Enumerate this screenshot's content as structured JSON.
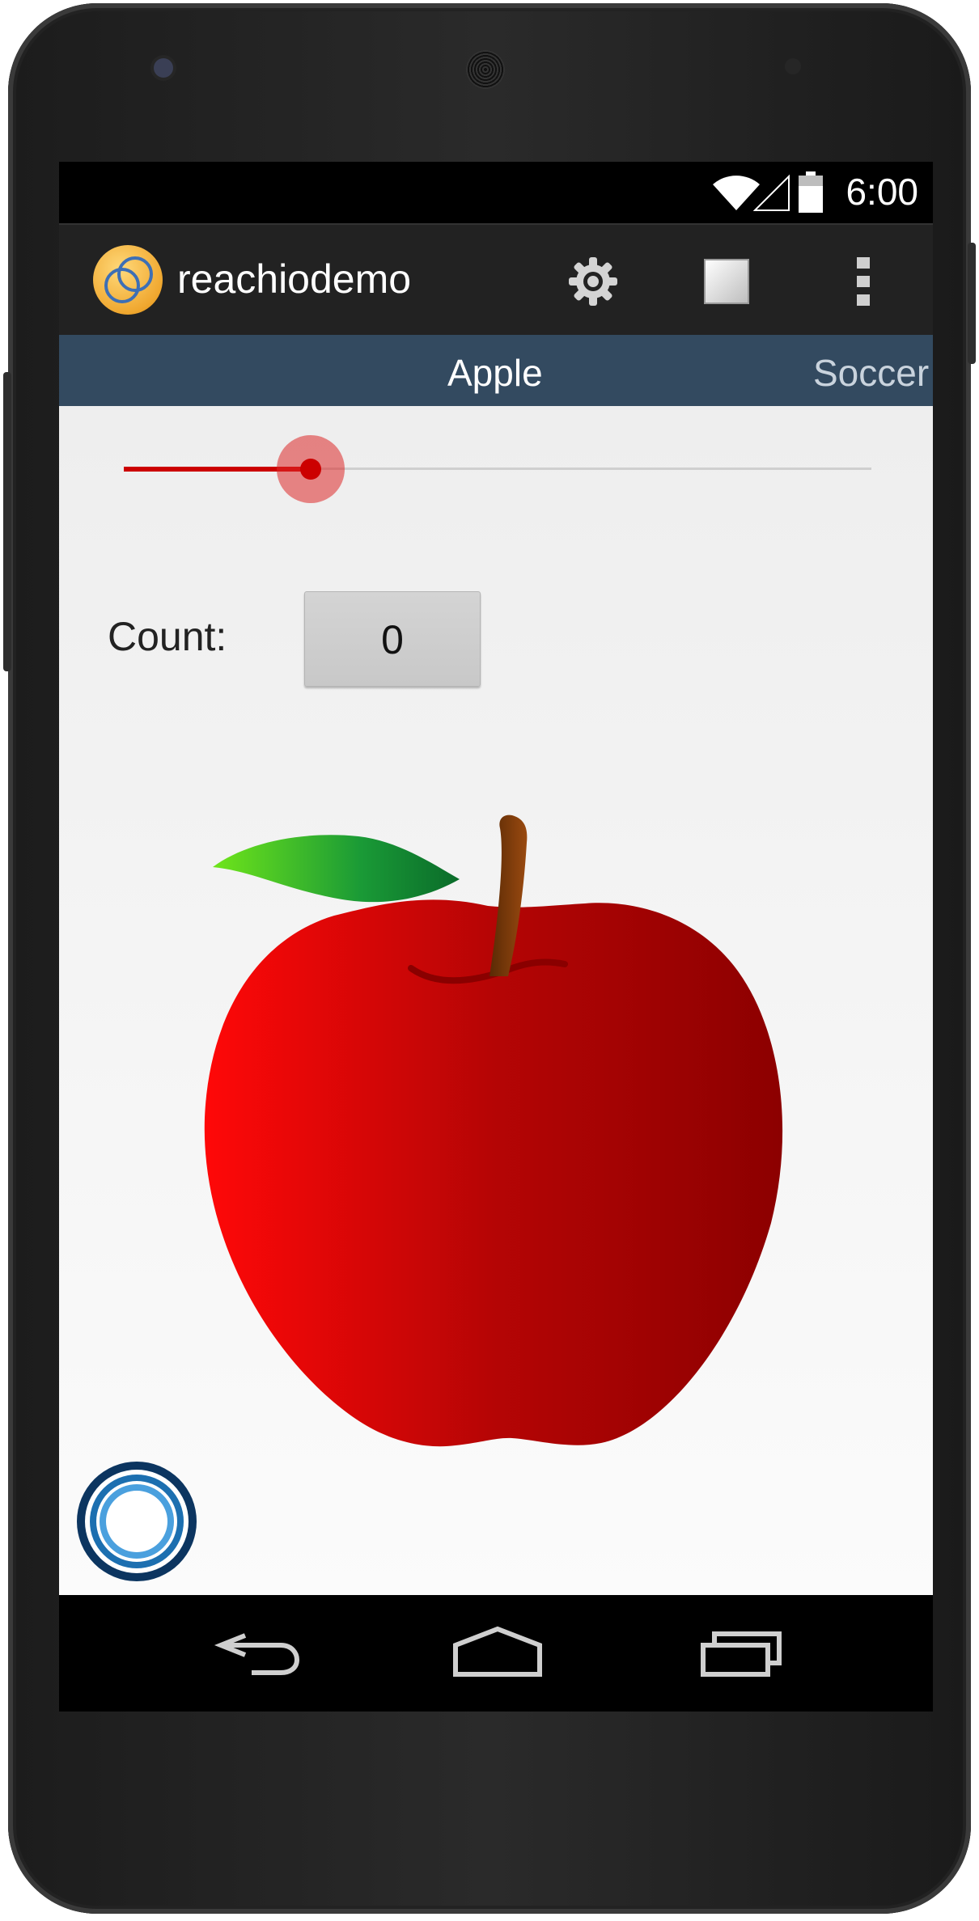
{
  "status_bar": {
    "time": "6:00",
    "icons": [
      "wifi-icon",
      "cell-signal-icon",
      "battery-icon"
    ]
  },
  "action_bar": {
    "app_title": "reachiodemo",
    "app_icon": "reachio-logo-icon",
    "actions": [
      "settings-gear-icon",
      "square-icon",
      "overflow-menu-icon"
    ]
  },
  "tabs": [
    {
      "label": "Apple",
      "selected": true
    },
    {
      "label": "Soccer",
      "selected": false
    }
  ],
  "slider": {
    "value_fraction": 0.25,
    "color": "#cc0000"
  },
  "counter": {
    "label": "Count:",
    "value": "0"
  },
  "image": {
    "subject": "red-apple-illustration"
  },
  "fab": {
    "icon": "reachio-ring-icon"
  },
  "nav_bar": {
    "buttons": [
      "back-icon",
      "home-icon",
      "recents-icon"
    ]
  }
}
